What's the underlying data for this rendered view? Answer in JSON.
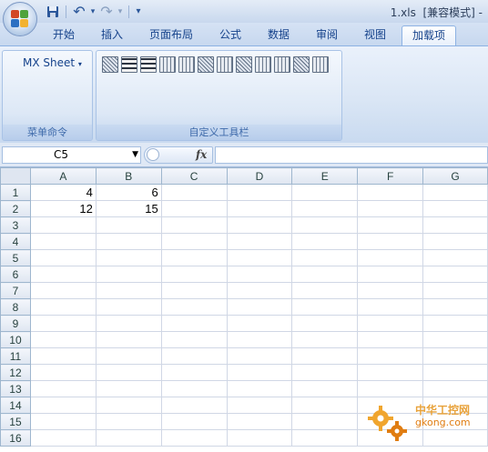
{
  "title_bar": {
    "title": "1.xls  [兼容模式] -"
  },
  "quick_access": {
    "items": [
      {
        "icon": "save-icon",
        "glyph": "💾"
      },
      {
        "icon": "undo-icon",
        "glyph": "↶"
      },
      {
        "icon": "undo-dropdown-icon",
        "glyph": "▾"
      },
      {
        "icon": "redo-icon",
        "glyph": "↷"
      },
      {
        "icon": "redo-dropdown-icon",
        "glyph": "▾"
      },
      {
        "icon": "customize-qat-icon",
        "glyph": "⁼"
      }
    ]
  },
  "ribbon_tabs": [
    "开始",
    "插入",
    "页面布局",
    "公式",
    "数据",
    "审阅",
    "视图",
    "加载项"
  ],
  "active_tab": "加载项",
  "groups": {
    "menu_commands": {
      "button": "MX Sheet",
      "label": "菜单命令"
    },
    "custom_toolbar": {
      "label": "自定义工具栏",
      "icon_count_note": ""
    }
  },
  "formula_bar": {
    "name_box": "C5",
    "fx": "fx",
    "value": ""
  },
  "sheet": {
    "columns": [
      "A",
      "B",
      "C",
      "D",
      "E",
      "F",
      "G"
    ],
    "rows": [
      {
        "n": "1",
        "A": "4",
        "B": "6"
      },
      {
        "n": "2",
        "A": "12",
        "B": "15"
      },
      {
        "n": "3"
      },
      {
        "n": "4"
      },
      {
        "n": "5"
      },
      {
        "n": "6"
      },
      {
        "n": "7"
      },
      {
        "n": "8"
      },
      {
        "n": "9"
      },
      {
        "n": "10"
      },
      {
        "n": "11"
      },
      {
        "n": "12"
      },
      {
        "n": "13"
      },
      {
        "n": "14"
      },
      {
        "n": "15"
      },
      {
        "n": "16"
      }
    ]
  },
  "watermark": {
    "line1": "中华工控网",
    "line2": "gkong.com"
  },
  "colors": {
    "accent": "#15428b",
    "office_red": "#d24726",
    "office_green": "#4fa33b",
    "office_blue": "#2b6fc2",
    "office_yellow": "#f2b230"
  }
}
